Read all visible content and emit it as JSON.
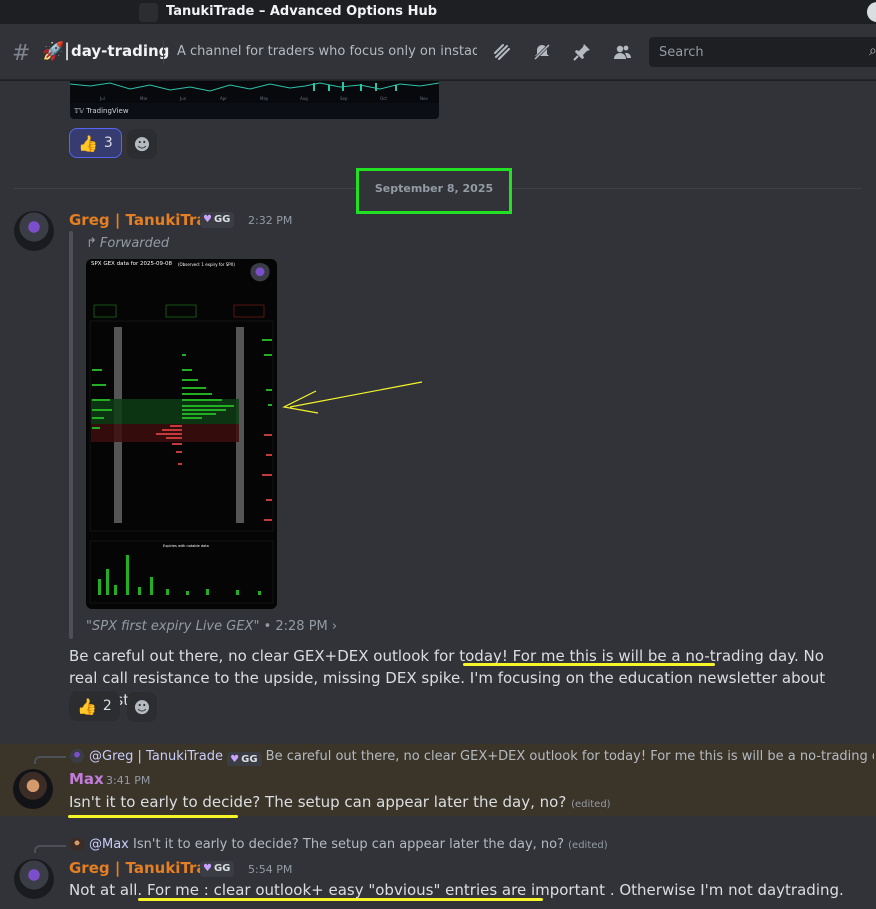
{
  "window": {
    "title": "TanukiTrade – Advanced Options Hub"
  },
  "header": {
    "channel_name": "day-trading",
    "channel_emoji": "🚀",
    "topic": "A channel for traders who focus only on instada...",
    "search_placeholder": "Search",
    "icons": [
      "threads-icon",
      "mute-icon",
      "pin-icon",
      "members-icon"
    ]
  },
  "embed_tail": {
    "brand": "TradingView"
  },
  "reactions_top": [
    {
      "emoji": "👍",
      "count": "3",
      "active": true
    }
  ],
  "date_divider": "September 8, 2025",
  "messages": [
    {
      "author": "Greg | TanukiTrade",
      "tag": "GG",
      "time": "2:32 PM",
      "forwarded_label": "Forwarded",
      "image": {
        "title": "SPX GEX data for 2025-09-08",
        "subtitle": "(Observed: 1 expiry for SPX)",
        "lower_title": "Expiries with notable data"
      },
      "caption_quote": "\"SPX first expiry Live GEX\"",
      "caption_time": "• 2:28 PM",
      "text_before": "Be careful out there, no clear GEX+DEX outlook for today! ",
      "text_highlight": "For me this is will be a no-trading day",
      "text_after": ". No real call resistance to the upside, missing DEX spike. I'm focusing on the education newsletter about these stuff.",
      "reactions": [
        {
          "emoji": "👍",
          "count": "2"
        }
      ]
    },
    {
      "reply_to_author": "@Greg | TanukiTrade",
      "reply_to_tag": "GG",
      "reply_to_text": "Be careful out there, no clear GEX+DEX outlook for today! For me this is will be a no-trading day. No r...",
      "author": "Max",
      "time": "3:41 PM",
      "text": "Isn't it to early to decide? The setup can appear later the day, no?",
      "edited": "(edited)"
    },
    {
      "reply_to_author": "@Max",
      "reply_to_text": "Isn't it to early to decide? The setup can appear later the day, no?",
      "reply_edited": "(edited)",
      "author": "Greg | TanukiTrade",
      "tag": "GG",
      "time": "5:54 PM",
      "text_before": "Not at all. ",
      "text_highlight": "For me : clear outlook+ easy \"obvious\" entries are important",
      "text_after": " . Otherwise I'm not daytrading."
    }
  ],
  "colors": {
    "greg_name": "#e67e22",
    "max_name": "#c27cda",
    "annotation_box": "#22e122",
    "annotation_marker": "#f5f52a",
    "reply_highlight_bg": "#3a3429"
  }
}
